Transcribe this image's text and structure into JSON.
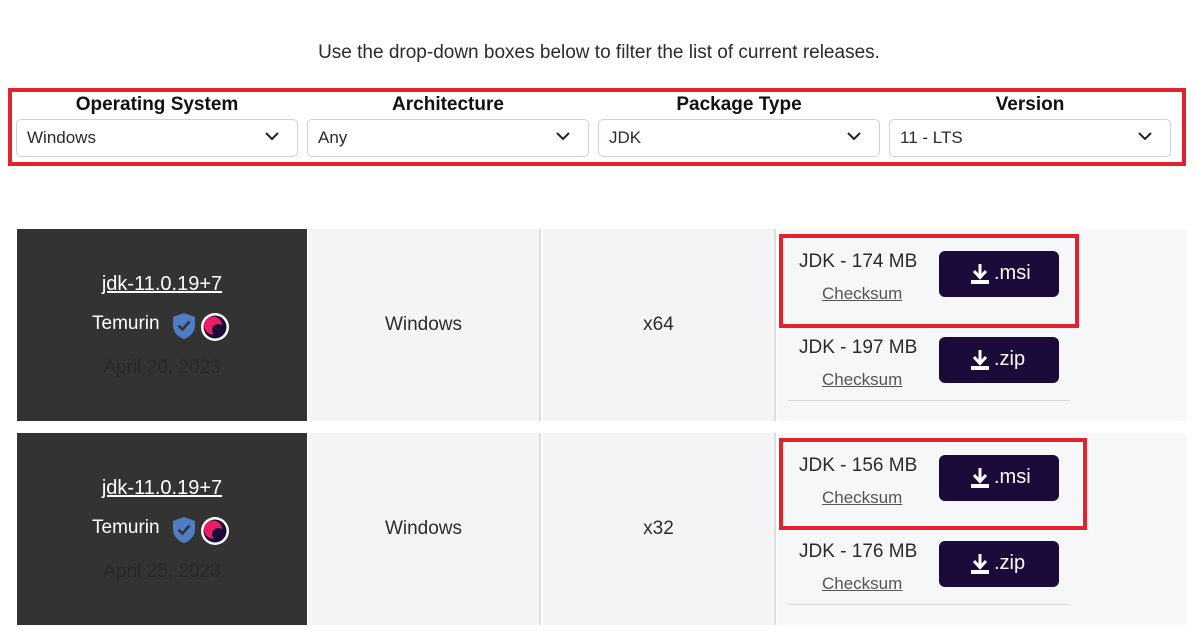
{
  "intro": "Use the drop-down boxes below to filter the list of current releases.",
  "filters": [
    {
      "label": "Operating System",
      "value": "Windows"
    },
    {
      "label": "Architecture",
      "value": "Any"
    },
    {
      "label": "Package Type",
      "value": "JDK"
    },
    {
      "label": "Version",
      "value": "11 - LTS"
    }
  ],
  "releases": [
    {
      "name": "jdk-11.0.19+7",
      "vendor": "Temurin",
      "date": "April 20, 2023",
      "os": "Windows",
      "arch": "x64",
      "packages": [
        {
          "label": "JDK - 174 MB",
          "checksum": "Checksum",
          "button": ".msi"
        },
        {
          "label": "JDK - 197 MB",
          "checksum": "Checksum",
          "button": ".zip"
        }
      ]
    },
    {
      "name": "jdk-11.0.19+7",
      "vendor": "Temurin",
      "date": "April 25, 2023",
      "os": "Windows",
      "arch": "x32",
      "packages": [
        {
          "label": "JDK - 156 MB",
          "checksum": "Checksum",
          "button": ".msi"
        },
        {
          "label": "JDK - 176 MB",
          "checksum": "Checksum",
          "button": ".zip"
        }
      ]
    }
  ],
  "icons": {
    "chevron": "chevron-down-icon",
    "shield": "verified-shield-icon",
    "logo": "eclipse-logo-icon",
    "download": "download-icon"
  },
  "colors": {
    "highlight": "#e0232e",
    "button": "#1b0a3a",
    "release_cell": "#333333",
    "shield": "#4e7dc3",
    "logo": "#e91e63"
  }
}
